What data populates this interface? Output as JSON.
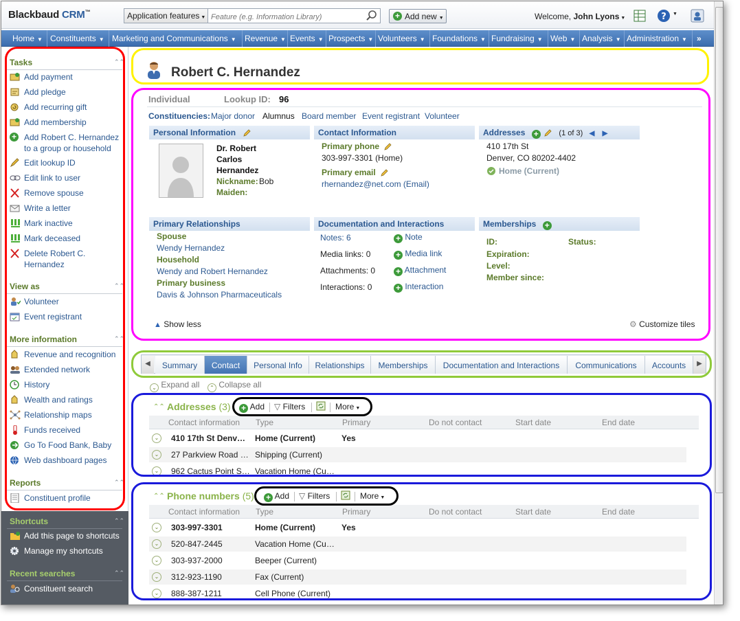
{
  "app": {
    "brand": "Blackbaud",
    "brand_suffix": "CRM",
    "trademark": "™"
  },
  "search": {
    "scope": "Application features",
    "placeholder": "Feature (e.g. Information Library)"
  },
  "toolbar": {
    "add_new": "Add new",
    "welcome": "Welcome,",
    "user": "John Lyons"
  },
  "menu": [
    "Home",
    "Constituents",
    "Marketing and Communications",
    "Revenue",
    "Events",
    "Prospects",
    "Volunteers",
    "Foundations",
    "Fundraising",
    "Web",
    "Analysis",
    "Administration"
  ],
  "menu_more": "»",
  "tasks": {
    "header": "Tasks",
    "items": [
      "Add payment",
      "Add pledge",
      "Add recurring gift",
      "Add membership",
      "Add Robert C. Hernandez",
      "to a group or household",
      "Edit lookup ID",
      "Edit link to user",
      "Remove spouse",
      "Write a letter",
      "Mark inactive",
      "Mark deceased",
      "Delete Robert C.",
      "Hernandez"
    ]
  },
  "view_as": {
    "header": "View as",
    "items": [
      "Volunteer",
      "Event registrant"
    ]
  },
  "more_info": {
    "header": "More information",
    "items": [
      "Revenue and recognition",
      "Extended network",
      "History",
      "Wealth and ratings",
      "Relationship maps",
      "Funds received",
      "Go To Food Bank, Baby",
      "Web dashboard pages"
    ]
  },
  "reports": {
    "header": "Reports",
    "items": [
      "Constituent profile"
    ]
  },
  "shortcuts": {
    "header": "Shortcuts",
    "items": [
      "Add this page to shortcuts",
      "Manage my shortcuts"
    ]
  },
  "recent": {
    "header": "Recent searches",
    "items": [
      "Constituent search"
    ]
  },
  "page": {
    "title": "Robert C. Hernandez"
  },
  "summary": {
    "type": "Individual",
    "lookup_label": "Lookup ID:",
    "lookup_id": "96",
    "constituencies_label": "Constituencies:",
    "constituencies": [
      "Major donor",
      "Alumnus",
      "Board member",
      "Event registrant",
      "Volunteer"
    ],
    "personal": {
      "header": "Personal Information",
      "name1": "Dr. Robert",
      "name2": "Carlos",
      "name3": "Hernandez",
      "nickname_label": "Nickname:",
      "nickname": "Bob",
      "maiden_label": "Maiden:"
    },
    "contact": {
      "header": "Contact Information",
      "phone_label": "Primary phone",
      "phone": "303-997-3301 (Home)",
      "email_label": "Primary email",
      "email": "rhernandez@net.com (Email)"
    },
    "addresses": {
      "header": "Addresses",
      "paging": "(1 of 3)",
      "line1": "410 17th St",
      "line2": "Denver, CO 80202-4402",
      "status": "Home (Current)"
    },
    "relationships": {
      "header": "Primary Relationships",
      "spouse_label": "Spouse",
      "spouse": "Wendy Hernandez",
      "household_label": "Household",
      "household": "Wendy and Robert Hernandez",
      "business_label": "Primary business",
      "business": "Davis & Johnson Pharmaceuticals"
    },
    "documentation": {
      "header": "Documentation and Interactions",
      "notes": "Notes: 6",
      "media": "Media links: 0",
      "attachments": "Attachments: 0",
      "interactions": "Interactions: 0",
      "add_note": "Note",
      "add_media": "Media link",
      "add_attachment": "Attachment",
      "add_interaction": "Interaction"
    },
    "memberships": {
      "header": "Memberships",
      "id_label": "ID:",
      "status_label": "Status:",
      "expiration_label": "Expiration:",
      "level_label": "Level:",
      "since_label": "Member since:"
    },
    "show_less": "Show less",
    "customize": "Customize tiles"
  },
  "tabs": {
    "items": [
      "Summary",
      "Contact",
      "Personal Info",
      "Relationships",
      "Memberships",
      "Documentation and Interactions",
      "Communications",
      "Accounts"
    ],
    "active": "Contact",
    "expand_all": "Expand all",
    "collapse_all": "Collapse all"
  },
  "grid_actions": {
    "add": "Add",
    "filters": "Filters",
    "more": "More"
  },
  "addresses_grid": {
    "title": "Addresses",
    "count": "(3)",
    "columns": [
      "Contact information",
      "Type",
      "Primary",
      "Do not contact",
      "Start date",
      "End date"
    ],
    "rows": [
      {
        "info": "410 17th St Denv…",
        "type": "Home (Current)",
        "primary": "Yes"
      },
      {
        "info": "27 Parkview Road …",
        "type": "Shipping (Current)",
        "primary": ""
      },
      {
        "info": "962 Cactus Point S…",
        "type": "Vacation Home (Cu…",
        "primary": ""
      }
    ]
  },
  "phones_grid": {
    "title": "Phone numbers",
    "count": "(5)",
    "columns": [
      "Contact information",
      "Type",
      "Primary",
      "Do not contact",
      "Start date",
      "End date"
    ],
    "rows": [
      {
        "info": "303-997-3301",
        "type": "Home (Current)",
        "primary": "Yes"
      },
      {
        "info": "520-847-2445",
        "type": "Vacation Home (Cu…",
        "primary": ""
      },
      {
        "info": "303-937-2000",
        "type": "Beeper (Current)",
        "primary": ""
      },
      {
        "info": "312-923-1190",
        "type": "Fax (Current)",
        "primary": ""
      },
      {
        "info": "888-387-1211",
        "type": "Cell Phone (Current)",
        "primary": ""
      }
    ]
  },
  "colors": {
    "menu": "#4a7ebf",
    "accent_green": "#8ab34a",
    "link": "#2b5890",
    "highlight_yellow": "#fff200",
    "highlight_red": "#ff0000",
    "highlight_magenta": "#ff00ff",
    "highlight_green": "#8fca3a",
    "highlight_blue": "#1a1adb"
  }
}
